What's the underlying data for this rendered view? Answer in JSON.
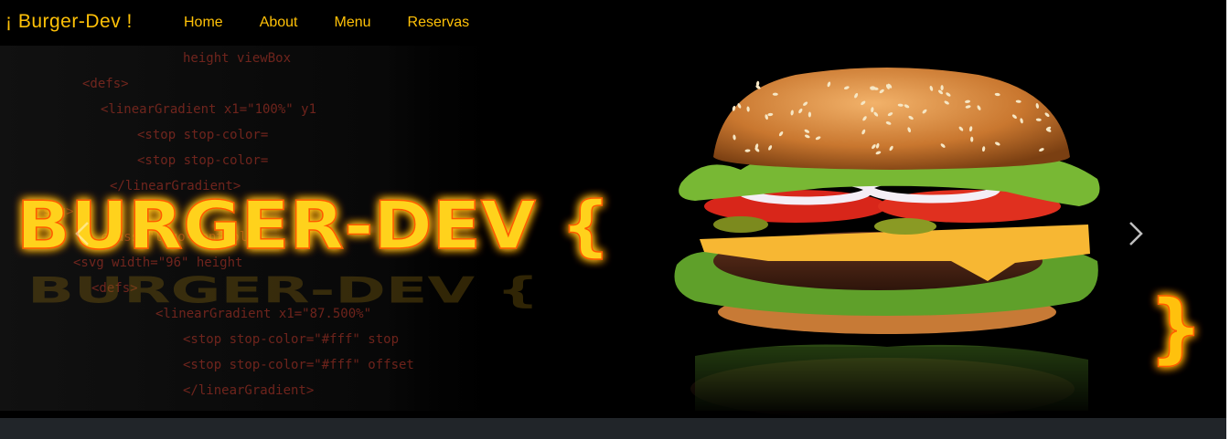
{
  "navbar": {
    "brand": "¡ Burger-Dev !",
    "links": [
      {
        "label": "Home"
      },
      {
        "label": "About"
      },
      {
        "label": "Menu"
      },
      {
        "label": "Reservas"
      }
    ]
  },
  "hero": {
    "title": "BURGER-DEV {",
    "closing_brace": "}",
    "code_lines": [
      "height  viewBox",
      "<defs>",
      "<linearGradient x1=\"100%\" y1",
      "<stop stop-color=",
      "<stop stop-color=",
      "</linearGradient>",
      "</svg>",
      "class=\"logo-control\"",
      "<svg width=\"96\" height",
      "<defs>",
      "<linearGradient x1=\"87.500%\"",
      "<stop stop-color=\"#fff\" stop",
      "<stop stop-color=\"#fff\" offset",
      "</linearGradient>"
    ]
  },
  "colors": {
    "accent": "#ffc107",
    "neon": "#ffd21a",
    "glow": "#ff6a00",
    "footer_bg": "#212529"
  },
  "icons": {
    "prev": "chevron-left-icon",
    "next": "chevron-right-icon"
  }
}
